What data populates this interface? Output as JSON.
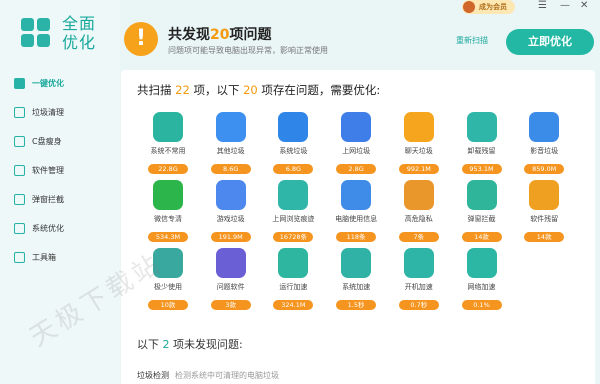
{
  "app": {
    "logo_text": "全面优化"
  },
  "topbar": {
    "vip_label": "成为会员",
    "icons": [
      "menu-icon",
      "minimize-icon",
      "close-icon"
    ]
  },
  "sidebar": {
    "items": [
      {
        "label": "一键优化",
        "icon": "lightning-icon",
        "active": true
      },
      {
        "label": "垃圾清理",
        "icon": "trash-icon"
      },
      {
        "label": "C盘瘦身",
        "icon": "disk-icon"
      },
      {
        "label": "软件管理",
        "icon": "software-icon"
      },
      {
        "label": "弹窗拦截",
        "icon": "popup-icon"
      },
      {
        "label": "系统优化",
        "icon": "system-icon"
      },
      {
        "label": "工具箱",
        "icon": "toolbox-icon"
      }
    ]
  },
  "header": {
    "title_pre": "共发现",
    "title_num": "20",
    "title_post": "项问题",
    "subtitle": "问题项可能导致电脑出现异常，影响正常使用",
    "rescan_label": "重新扫描",
    "optimize_label": "立即优化"
  },
  "panel": {
    "scan_pre": "共扫描 ",
    "scan_total": "22",
    "scan_mid": " 项，以下 ",
    "scan_issues": "20",
    "scan_post": " 项存在问题，需要优化:",
    "items": [
      {
        "label": "系统不常用",
        "badge": "22.8G",
        "color": "#2bb5a0",
        "icon": "system-unused-icon",
        "badge_color": "orange"
      },
      {
        "label": "其他垃圾",
        "badge": "8.6G",
        "color": "#3d8ff0",
        "icon": "other-junk-icon",
        "badge_color": "orange"
      },
      {
        "label": "系统垃圾",
        "badge": "6.8G",
        "color": "#2f86e8",
        "icon": "windows-icon",
        "badge_color": "orange"
      },
      {
        "label": "上网垃圾",
        "badge": "2.8G",
        "color": "#3f7ee8",
        "icon": "browser-icon",
        "badge_color": "orange"
      },
      {
        "label": "聊天垃圾",
        "badge": "992.1M",
        "color": "#f5a51e",
        "icon": "chat-icon",
        "badge_color": "orange"
      },
      {
        "label": "卸载残留",
        "badge": "953.1M",
        "color": "#2fb6a8",
        "icon": "recycle-icon",
        "badge_color": "orange"
      },
      {
        "label": "影音垃圾",
        "badge": "859.0M",
        "color": "#3b8be8",
        "icon": "film-icon",
        "badge_color": "orange"
      },
      {
        "label": "微信专清",
        "badge": "534.3M",
        "color": "#2bb54a",
        "icon": "wechat-icon",
        "badge_color": "orange"
      },
      {
        "label": "游戏垃圾",
        "badge": "191.9M",
        "color": "#4c88ee",
        "icon": "game-icon",
        "badge_color": "orange"
      },
      {
        "label": "上网浏览痕迹",
        "badge": "16728条",
        "color": "#2fb6a8",
        "icon": "browse-trace-icon",
        "badge_color": "orange"
      },
      {
        "label": "电脑使用信息",
        "badge": "118条",
        "color": "#3f8be8",
        "icon": "pc-info-icon",
        "badge_color": "orange"
      },
      {
        "label": "高危隐私",
        "badge": "7条",
        "color": "#e9962a",
        "icon": "privacy-icon",
        "badge_color": "orange"
      },
      {
        "label": "弹窗拦截",
        "badge": "14款",
        "color": "#2fb59a",
        "icon": "block-icon",
        "badge_color": "orange"
      },
      {
        "label": "软件残留",
        "badge": "14款",
        "color": "#f0a020",
        "icon": "software-residue-icon",
        "badge_color": "orange"
      },
      {
        "label": "极少使用",
        "badge": "10款",
        "color": "#39a9a0",
        "icon": "cobweb-icon",
        "badge_color": "orange"
      },
      {
        "label": "问题软件",
        "badge": "3款",
        "color": "#6b5fd6",
        "icon": "bad-software-icon",
        "badge_color": "orange"
      },
      {
        "label": "运行加速",
        "badge": "324.1M",
        "color": "#2fb6a0",
        "icon": "run-speed-icon",
        "badge_color": "orange"
      },
      {
        "label": "系统加速",
        "badge": "1.5秒",
        "color": "#30b3a6",
        "icon": "sliders-icon",
        "badge_color": "orange"
      },
      {
        "label": "开机加速",
        "badge": "0.7秒",
        "color": "#2fb5a8",
        "icon": "rocket-icon",
        "badge_color": "orange"
      },
      {
        "label": "网络加速",
        "badge": "0.1%",
        "color": "#2bb7a4",
        "icon": "router-icon",
        "badge_color": "orange"
      }
    ],
    "no_issue_pre": "以下 ",
    "no_issue_num": "2",
    "no_issue_post": " 项未发现问题:",
    "last_row_label": "垃圾检测",
    "last_row_hint": "检测系统中可清理的电脑垃圾"
  },
  "watermark": "天极下载站",
  "colors": {
    "accent": "#22b8a3",
    "highlight": "#f59a0e",
    "warning": "#f7a21b"
  }
}
